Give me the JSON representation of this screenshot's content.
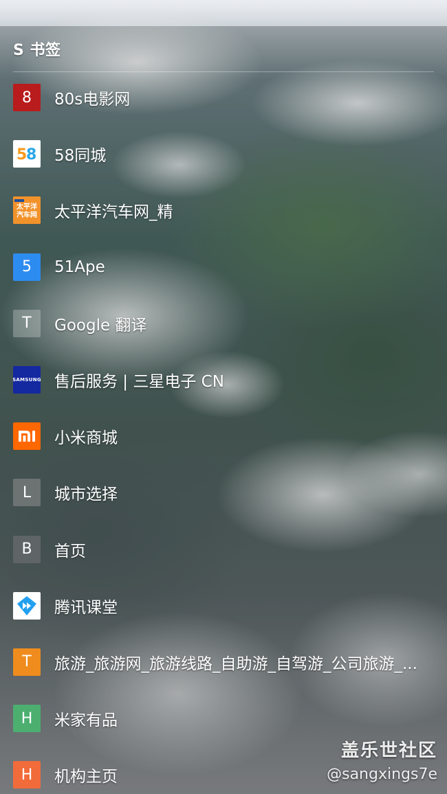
{
  "header": {
    "title": "S 书签"
  },
  "bookmarks": [
    {
      "label": "80s电影网",
      "icon": {
        "type": "letter",
        "text": "8",
        "bg": "#b81c1c",
        "name": "letter-8-icon"
      }
    },
    {
      "label": "58同城",
      "icon": {
        "type": "logo",
        "text": "58",
        "bg": "#ffffff",
        "name": "58tongcheng-logo-icon"
      }
    },
    {
      "label": "太平洋汽车网_精",
      "icon": {
        "type": "logo",
        "text": "太平洋汽车网",
        "bg": "#f2922b",
        "name": "pcauto-logo-icon"
      }
    },
    {
      "label": "51Ape",
      "icon": {
        "type": "letter",
        "text": "5",
        "bg": "#2d8cf0",
        "name": "letter-5-icon"
      }
    },
    {
      "label": "Google 翻译",
      "icon": {
        "type": "letter",
        "text": "T",
        "bg": "rgba(255,255,255,0.25)",
        "name": "letter-t-icon"
      }
    },
    {
      "label": "售后服务 | 三星电子 CN",
      "icon": {
        "type": "logo",
        "text": "SAMSUNG",
        "bg": "#1428a0",
        "name": "samsung-logo-icon"
      }
    },
    {
      "label": "小米商城",
      "icon": {
        "type": "logo",
        "text": "mi",
        "bg": "#ff6700",
        "name": "xiaomi-logo-icon"
      }
    },
    {
      "label": "城市选择",
      "icon": {
        "type": "letter",
        "text": "L",
        "bg": "#6d7373",
        "name": "letter-l-icon"
      }
    },
    {
      "label": "首页",
      "icon": {
        "type": "letter",
        "text": "B",
        "bg": "#5f6567",
        "name": "letter-b-icon"
      }
    },
    {
      "label": "腾讯课堂",
      "icon": {
        "type": "logo",
        "text": "",
        "bg": "#ffffff",
        "name": "tencent-classroom-logo-icon"
      }
    },
    {
      "label": "旅游_旅游网_旅游线路_自助游_自驾游_公司旅游_...",
      "icon": {
        "type": "letter",
        "text": "T",
        "bg": "#ef8c1d",
        "name": "letter-t-orange-icon"
      }
    },
    {
      "label": "米家有品",
      "icon": {
        "type": "letter",
        "text": "H",
        "bg": "#4caf70",
        "name": "letter-h-green-icon"
      }
    },
    {
      "label": "机构主页",
      "icon": {
        "type": "letter",
        "text": "H",
        "bg": "#f26b3a",
        "name": "letter-h-orange-icon"
      }
    }
  ],
  "watermark": {
    "line1": "盖乐世社区",
    "line2": "@sangxings7e"
  }
}
